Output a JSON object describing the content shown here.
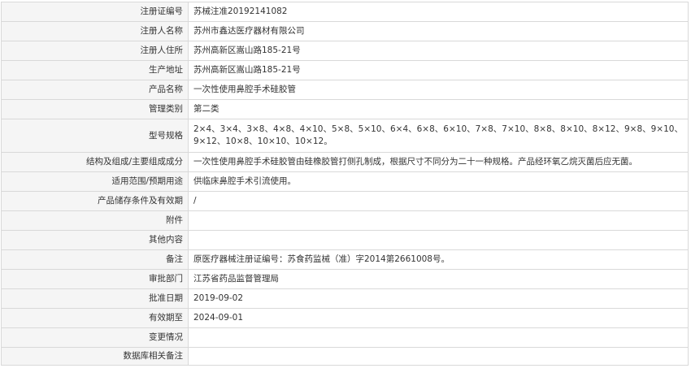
{
  "rows": [
    {
      "label": "注册证编号",
      "value": "苏械注准20192141082"
    },
    {
      "label": "注册人名称",
      "value": "苏州市鑫达医疗器材有限公司"
    },
    {
      "label": "注册人住所",
      "value": "苏州高新区嵩山路185-21号"
    },
    {
      "label": "生产地址",
      "value": "苏州高新区嵩山路185-21号"
    },
    {
      "label": "产品名称",
      "value": "一次性使用鼻腔手术硅胶管"
    },
    {
      "label": "管理类别",
      "value": "第二类"
    },
    {
      "label": "型号规格",
      "value": "2×4、3×4、3×8、4×8、4×10、5×8、5×10、6×4、6×8、6×10、7×8、7×10、8×8、8×10、8×12、9×8、9×10、9×12、10×8、10×10、10×12。"
    },
    {
      "label": "结构及组成/主要组成成分",
      "value": "一次性使用鼻腔手术硅胶管由硅橡胶管打侧孔制成，根据尺寸不同分为二十一种规格。产品经环氧乙烷灭菌后应无菌。"
    },
    {
      "label": "适用范围/预期用途",
      "value": "供临床鼻腔手术引流使用。"
    },
    {
      "label": "产品储存条件及有效期",
      "value": "/"
    },
    {
      "label": "附件",
      "value": ""
    },
    {
      "label": "其他内容",
      "value": ""
    },
    {
      "label": "备注",
      "value": "原医疗器械注册证编号：苏食药监械（准）字2014第2661008号。"
    },
    {
      "label": "审批部门",
      "value": "江苏省药品监督管理局"
    },
    {
      "label": "批准日期",
      "value": "2019-09-02"
    },
    {
      "label": "有效期至",
      "value": "2024-09-01"
    },
    {
      "label": "变更情况",
      "value": ""
    },
    {
      "label": "数据库相关备注",
      "value": ""
    }
  ]
}
